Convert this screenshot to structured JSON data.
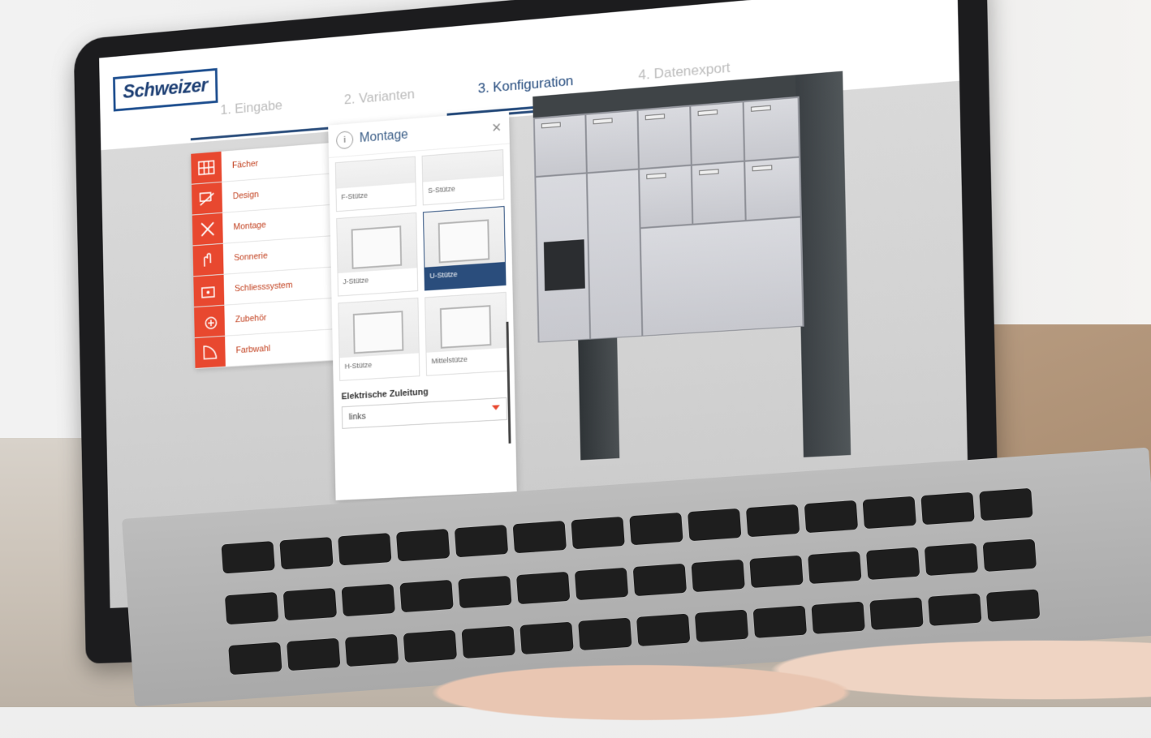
{
  "brand": {
    "logo_text": "Schweizer",
    "accent": "#e8482f",
    "primary": "#2a4d7c"
  },
  "steps": [
    {
      "label": "1. Eingabe",
      "active": false
    },
    {
      "label": "2. Varianten",
      "active": false
    },
    {
      "label": "3. Konfiguration",
      "active": true
    },
    {
      "label": "4. Datenexport",
      "active": false
    }
  ],
  "menu": {
    "items": [
      {
        "label": "Fächer",
        "icon": "grid-icon"
      },
      {
        "label": "Design",
        "icon": "design-icon"
      },
      {
        "label": "Montage",
        "icon": "tools-icon"
      },
      {
        "label": "Sonnerie",
        "icon": "bell-hand-icon"
      },
      {
        "label": "Schliesssystem",
        "icon": "lock-card-icon"
      },
      {
        "label": "Zubehör",
        "icon": "plus-box-icon"
      },
      {
        "label": "Farbwahl",
        "icon": "color-fan-icon"
      }
    ]
  },
  "panel": {
    "title": "Montage",
    "info_label": "i",
    "close_label": "×",
    "options": [
      {
        "label": "F-Stütze",
        "selected": false
      },
      {
        "label": "S-Stütze",
        "selected": false
      },
      {
        "label": "J-Stütze",
        "selected": false
      },
      {
        "label": "U-Stütze",
        "selected": true
      },
      {
        "label": "H-Stütze",
        "selected": false
      },
      {
        "label": "Mittelstütze",
        "selected": false
      }
    ],
    "electric": {
      "label": "Elektrische Zuleitung",
      "value": "links"
    }
  }
}
